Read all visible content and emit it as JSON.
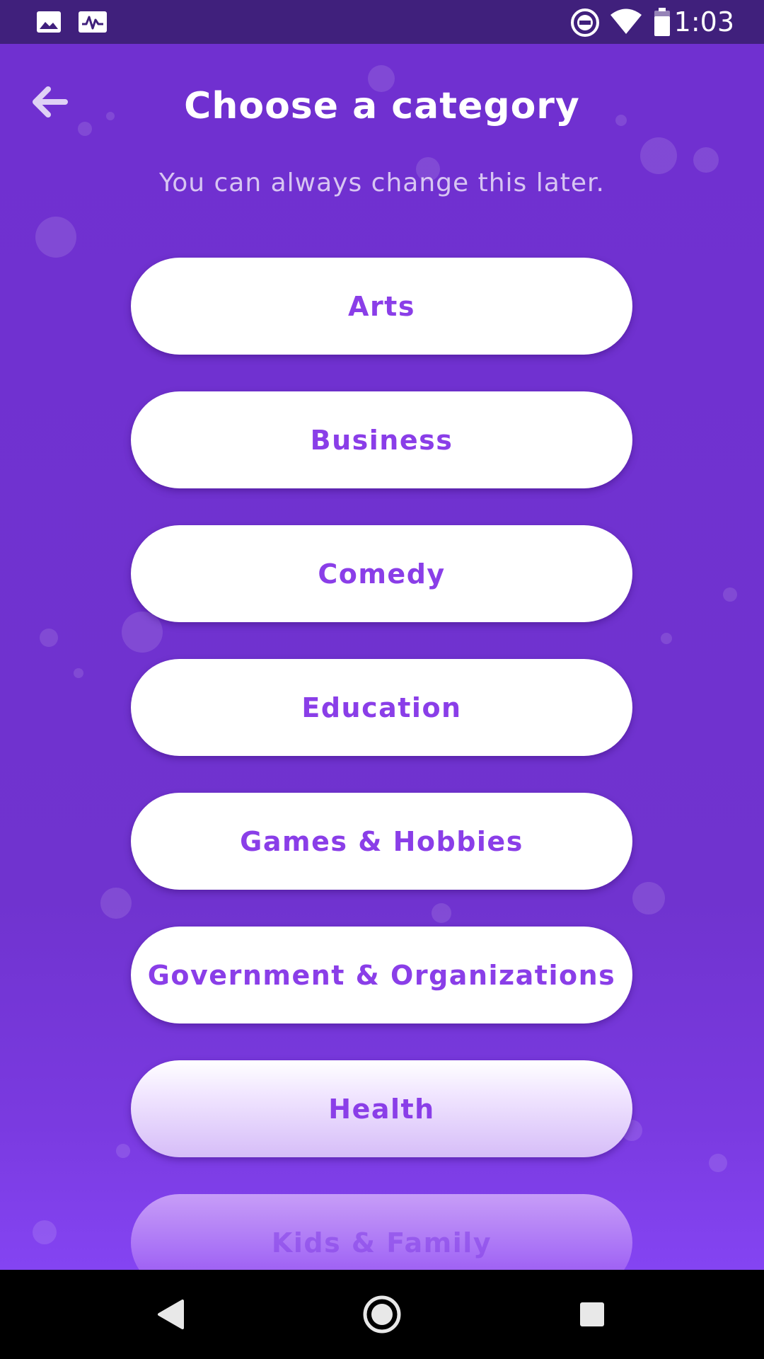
{
  "status_bar": {
    "time": "1:03",
    "left_icons": [
      "image-icon",
      "activity-icon"
    ],
    "right_icons": [
      "do-not-disturb-icon",
      "wifi-icon",
      "battery-icon"
    ]
  },
  "header": {
    "title": "Choose a category",
    "subtitle": "You can always change this later.",
    "back_icon": "arrow-left-icon"
  },
  "categories": [
    {
      "label": "Arts"
    },
    {
      "label": "Business"
    },
    {
      "label": "Comedy"
    },
    {
      "label": "Education"
    },
    {
      "label": "Games & Hobbies"
    },
    {
      "label": "Government & Organizations"
    },
    {
      "label": "Health"
    },
    {
      "label": "Kids & Family"
    }
  ],
  "nav_bar": {
    "icons": [
      "back-triangle-icon",
      "home-circle-icon",
      "recents-square-icon"
    ]
  },
  "colors": {
    "background": "#7033CF",
    "status_bar": "#40207C",
    "button_background": "#FFFFFF",
    "button_text": "#8A3EE8",
    "title_text": "#FFFFFF"
  }
}
